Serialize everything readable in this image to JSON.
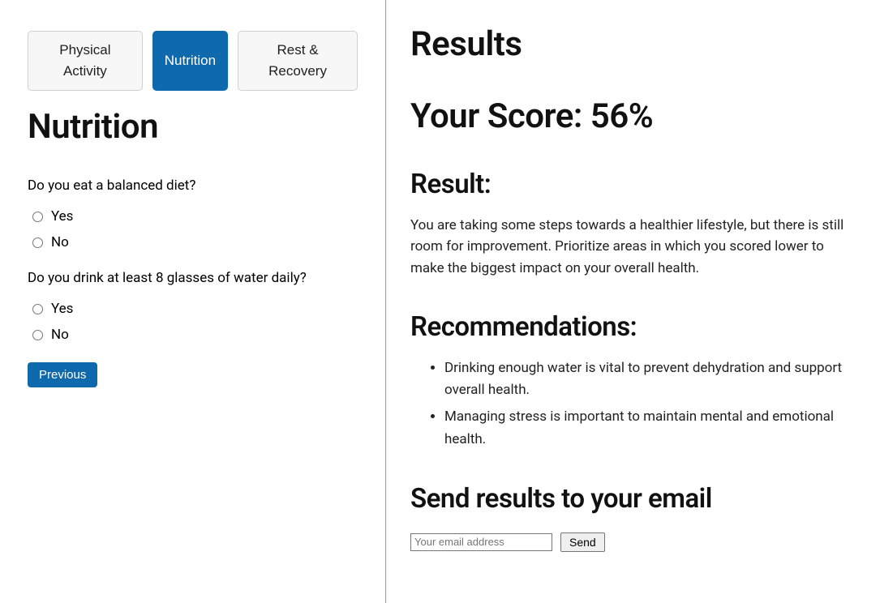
{
  "left": {
    "tabs": [
      {
        "label": "Physical Activity",
        "active": false
      },
      {
        "label": "Nutrition",
        "active": true
      },
      {
        "label": "Rest & Recovery",
        "active": false
      }
    ],
    "heading": "Nutrition",
    "questions": [
      {
        "text": "Do you eat a balanced diet?",
        "options": [
          "Yes",
          "No"
        ]
      },
      {
        "text": "Do you drink at least 8 glasses of water daily?",
        "options": [
          "Yes",
          "No"
        ]
      }
    ],
    "prev_label": "Previous"
  },
  "right": {
    "title": "Results",
    "score_label": "Your Score: ",
    "score_value": "56%",
    "result_heading": "Result:",
    "result_body": "You are taking some steps towards a healthier lifestyle, but there is still room for improvement. Prioritize areas in which you scored lower to make the biggest impact on your overall health.",
    "recommend_heading": "Recommendations:",
    "recommendations": [
      "Drinking enough water is vital to prevent dehydration and support overall health.",
      "Managing stress is important to maintain mental and emotional health."
    ],
    "email_heading": "Send results to your email",
    "email_placeholder": "Your email address",
    "send_label": "Send"
  }
}
